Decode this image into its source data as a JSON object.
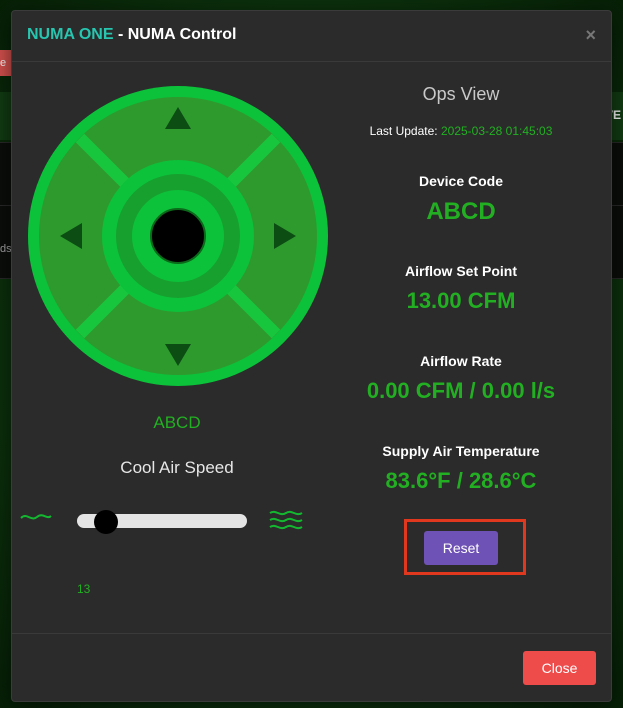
{
  "background": {
    "red_tab_label": "e",
    "right_fragment": "VE",
    "left_fragment": "ds"
  },
  "modal": {
    "brand": "NUMA ONE",
    "title_rest": " - NUMA Control",
    "close_icon": "×"
  },
  "controller": {
    "device_name": "ABCD",
    "speed_label": "Cool Air Speed",
    "slider_value": "13",
    "slider_fraction": 0.13
  },
  "ops": {
    "title": "Ops View",
    "last_update_label": "Last Update:",
    "last_update_value": "2025-03-28 01:45:03",
    "device_code_label": "Device Code",
    "device_code_value": "ABCD",
    "airflow_setpoint_label": "Airflow Set Point",
    "airflow_setpoint_value": "13.00 CFM",
    "airflow_rate_label": "Airflow Rate",
    "airflow_rate_value": "0.00 CFM / 0.00 l/s",
    "supply_temp_label": "Supply Air Temperature",
    "supply_temp_value": "83.6°F / 28.6°C",
    "reset_label": "Reset"
  },
  "footer": {
    "close_label": "Close"
  },
  "colors": {
    "accent_green": "#22b022",
    "brand_teal": "#26c6b0",
    "reset_purple": "#6f52b5",
    "close_red": "#ee4b4b",
    "highlight_red": "#e0381f"
  }
}
